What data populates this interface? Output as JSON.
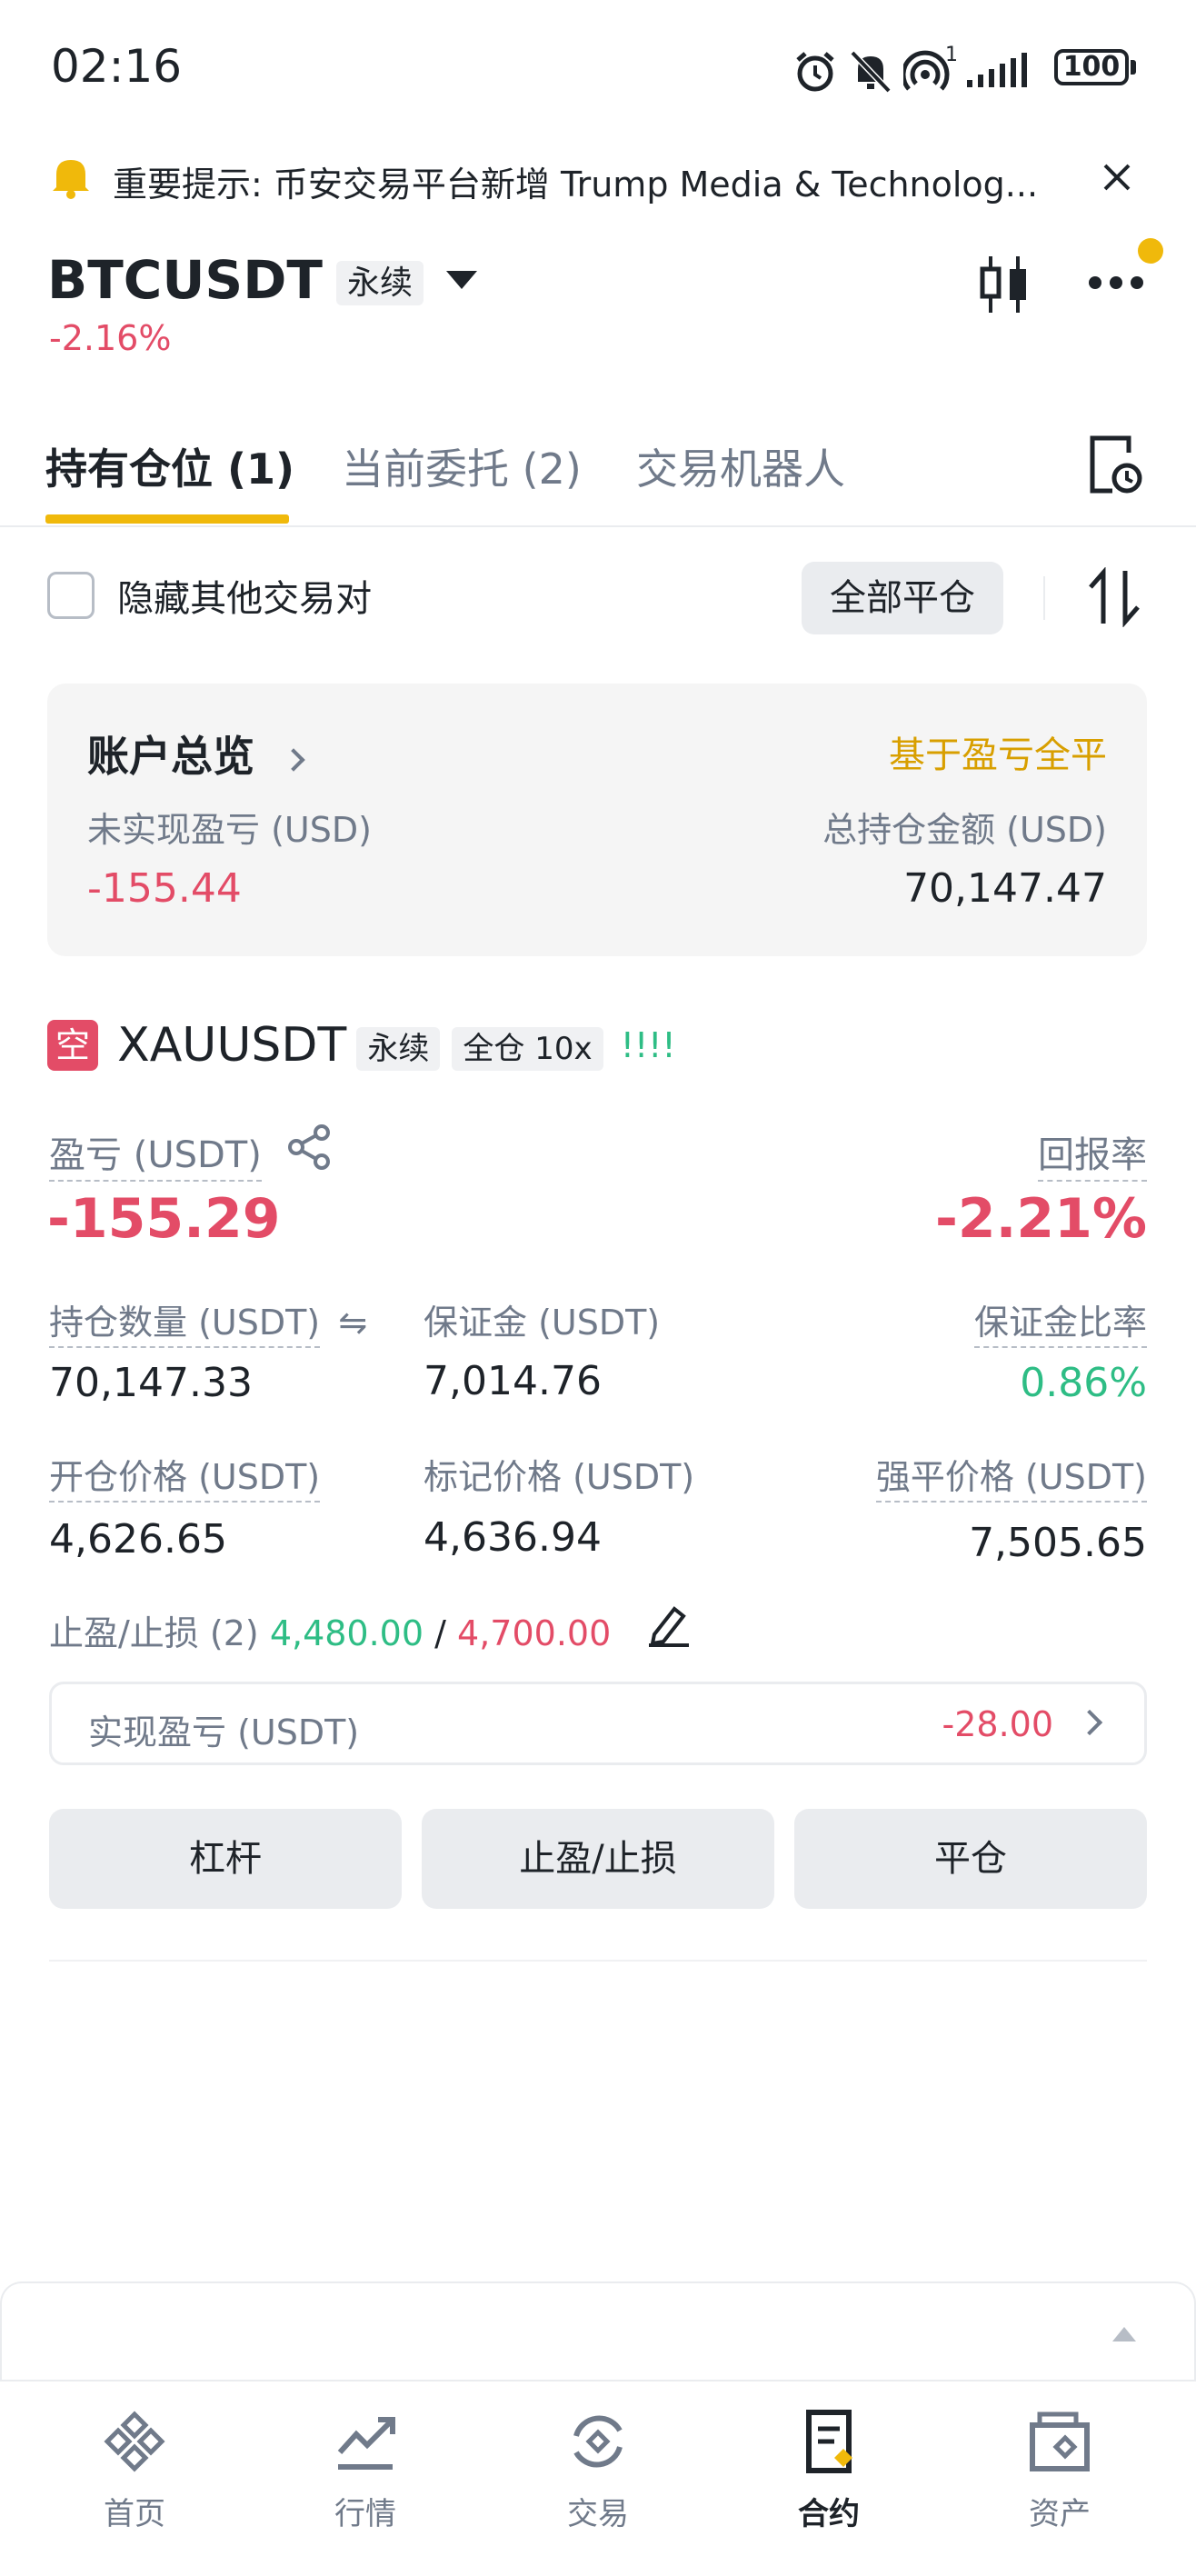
{
  "status_bar": {
    "time": "02:16",
    "signal_small": "1",
    "battery": "100",
    "icons": [
      "alarm-icon",
      "mute-icon",
      "hotspot-icon",
      "signal-icon",
      "battery-icon"
    ]
  },
  "notice": {
    "text": "重要提示: 币安交易平台新增 Trump Media & Technolog...",
    "icon": "bell-icon"
  },
  "header": {
    "symbol": "BTCUSDT",
    "contract_tag": "永续",
    "change_percent": "-2.16%"
  },
  "tabs": [
    {
      "label": "持有仓位 (1)",
      "active": true
    },
    {
      "label": "当前委托 (2)",
      "active": false
    },
    {
      "label": "交易机器人",
      "active": false
    }
  ],
  "filter": {
    "hide_others_label": "隐藏其他交易对",
    "close_all_label": "全部平仓"
  },
  "account": {
    "title": "账户总览",
    "close_by_pnl": "基于盈亏全平",
    "unrealized_label": "未实现盈亏 (USD)",
    "unrealized_value": "-155.44",
    "total_label": "总持仓金额 (USD)",
    "total_value": "70,147.47"
  },
  "position": {
    "side_badge": "空",
    "symbol": "XAUUSDT",
    "contract_tag": "永续",
    "margin_tag": "全仓 10x",
    "risk_bars": "!!!!",
    "pnl_label": "盈亏 (USDT)",
    "pnl_value": "-155.29",
    "roi_label": "回报率",
    "roi_value": "-2.21%",
    "size_label": "持仓数量 (USDT)",
    "size_value": "70,147.33",
    "margin_label": "保证金 (USDT)",
    "margin_value": "7,014.76",
    "margin_ratio_label": "保证金比率",
    "margin_ratio_value": "0.86%",
    "entry_label": "开仓价格 (USDT)",
    "entry_value": "4,626.65",
    "mark_label": "标记价格 (USDT)",
    "mark_value": "4,636.94",
    "liq_label": "强平价格 (USDT)",
    "liq_value": "7,505.65",
    "tpsl_label": "止盈/止损 (2)",
    "tp_value": "4,480.00",
    "tpsl_sep": "/",
    "sl_value": "4,700.00",
    "realized_label": "实现盈亏 (USDT)",
    "realized_value": "-28.00",
    "buttons": {
      "leverage": "杠杆",
      "tpsl": "止盈/止损",
      "close": "平仓"
    }
  },
  "bottom_nav": [
    {
      "label": "首页",
      "icon": "binance-logo-icon",
      "active": false
    },
    {
      "label": "行情",
      "icon": "market-chart-icon",
      "active": false
    },
    {
      "label": "交易",
      "icon": "trade-icon",
      "active": false
    },
    {
      "label": "合约",
      "icon": "futures-icon",
      "active": true
    },
    {
      "label": "资产",
      "icon": "wallet-icon",
      "active": false
    }
  ],
  "colors": {
    "accent_yellow": "#f0b90b",
    "red": "#e34c67",
    "green": "#2ebd85",
    "gold_text": "#d89f00"
  }
}
